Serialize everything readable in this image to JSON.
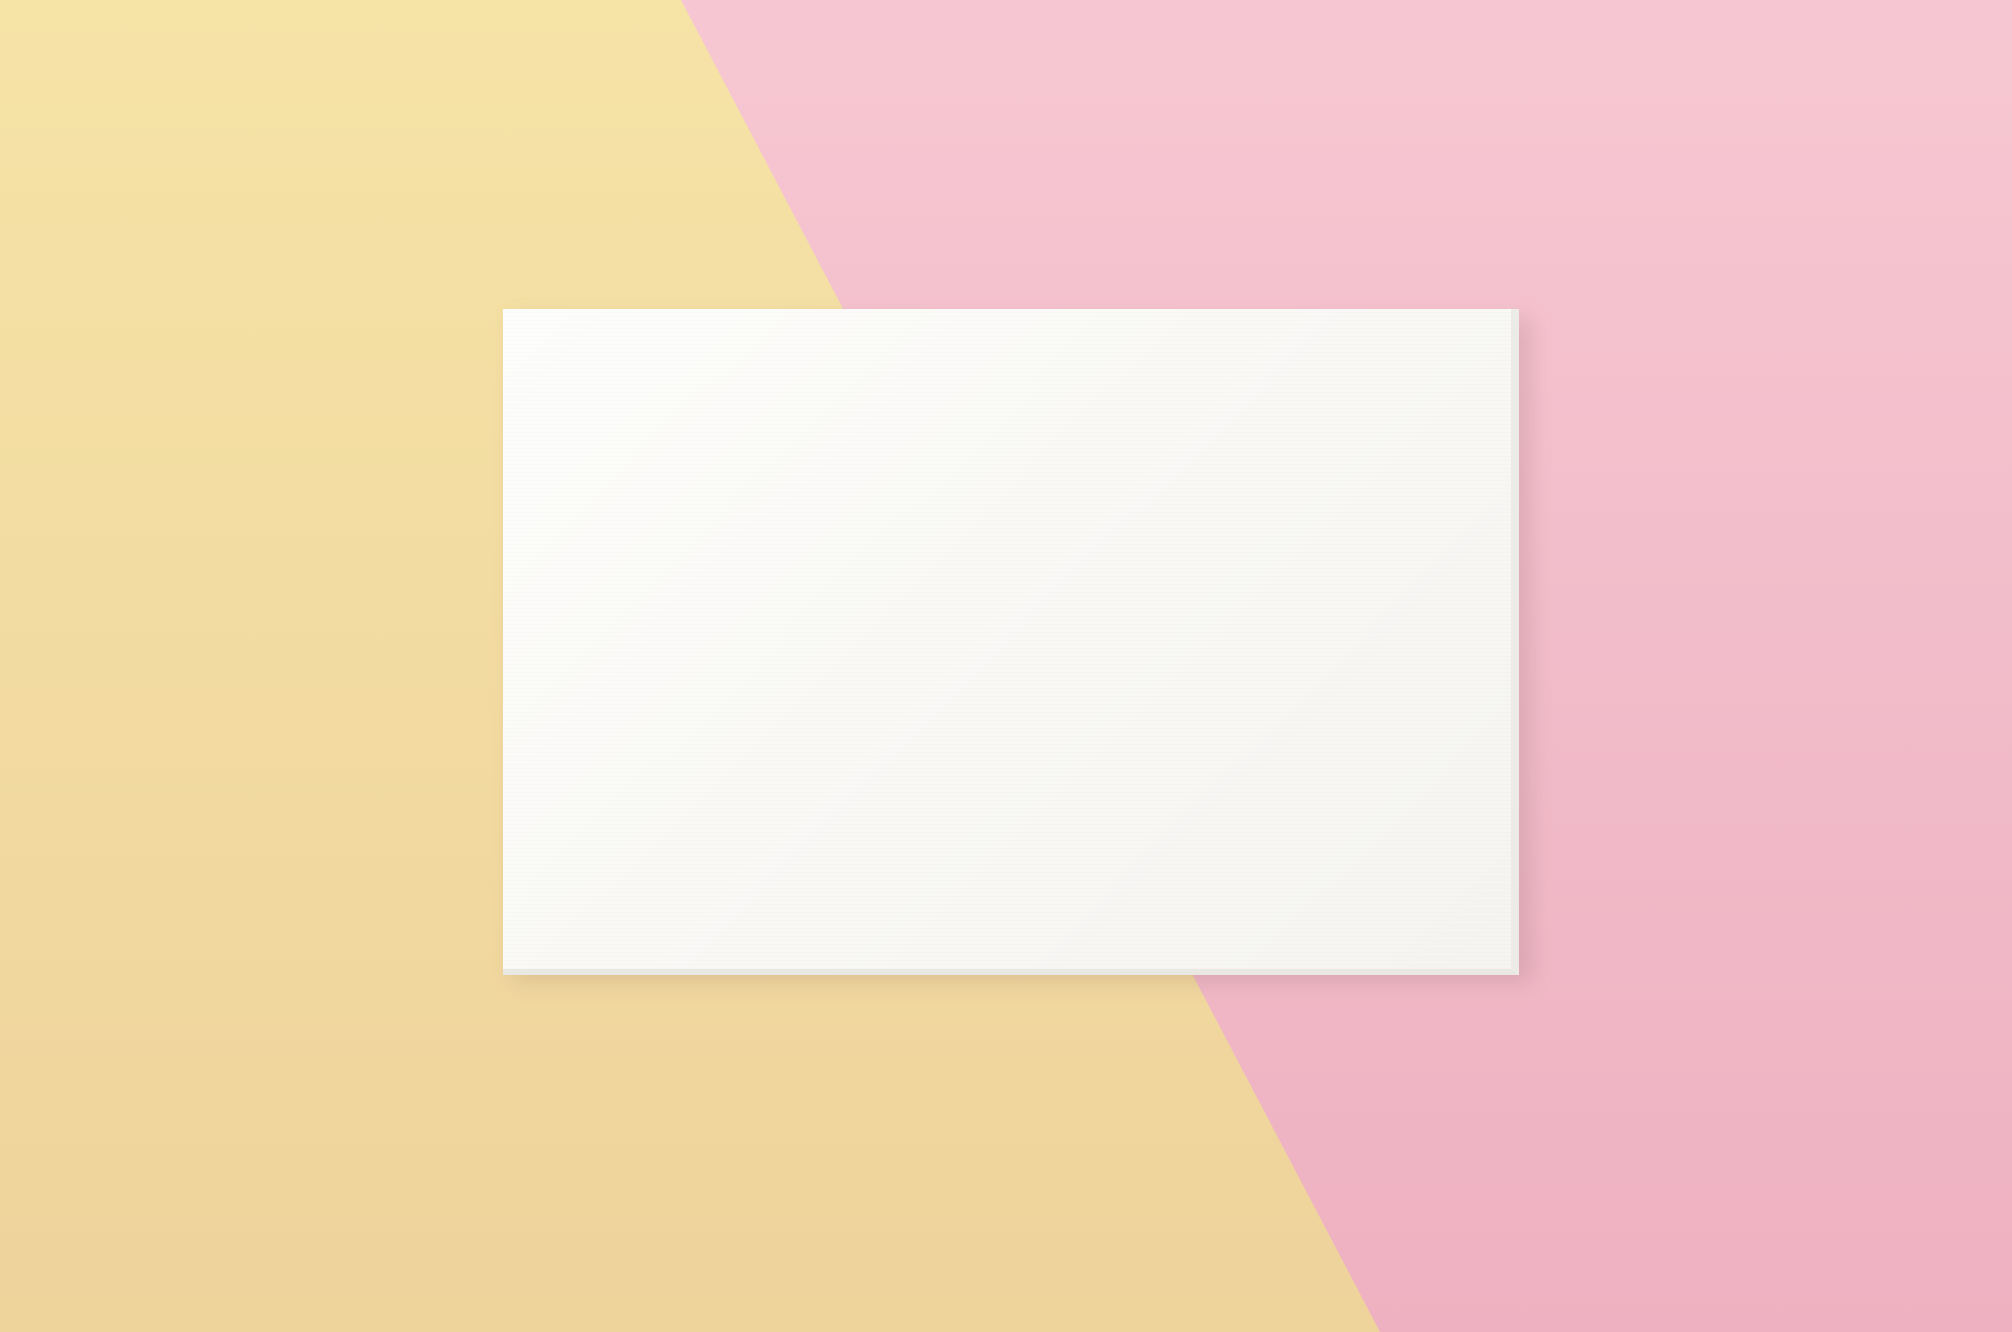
{
  "scene": {
    "subject": "blank-white-card",
    "colors": {
      "left_background": "#f4e1a3",
      "left_background_dark": "#eed49a",
      "right_background": "#f5c4d0",
      "right_background_dark": "#eeb3c2",
      "card": "#fbfbf9",
      "card_edge": "#ecebe7"
    }
  }
}
